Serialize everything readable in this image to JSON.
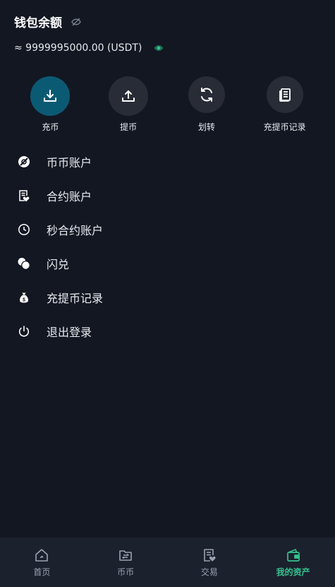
{
  "header": {
    "title": "钱包余额",
    "balance": "≈ 9999995000.00 (USDT)"
  },
  "actions": [
    {
      "label": "充币",
      "icon": "deposit-icon"
    },
    {
      "label": "提币",
      "icon": "withdraw-icon"
    },
    {
      "label": "划转",
      "icon": "transfer-icon"
    },
    {
      "label": "充提币记录",
      "icon": "records-icon"
    }
  ],
  "menu": [
    {
      "label": "币币账户",
      "icon": "coin-account-icon"
    },
    {
      "label": "合约账户",
      "icon": "contract-account-icon"
    },
    {
      "label": "秒合约账户",
      "icon": "clock-icon"
    },
    {
      "label": "闪兑",
      "icon": "flash-exchange-icon"
    },
    {
      "label": "充提币记录",
      "icon": "money-bag-icon"
    },
    {
      "label": "退出登录",
      "icon": "power-icon"
    }
  ],
  "tabs": [
    {
      "label": "首页",
      "icon": "home-icon"
    },
    {
      "label": "币币",
      "icon": "folder-icon"
    },
    {
      "label": "交易",
      "icon": "trade-icon"
    },
    {
      "label": "我的资产",
      "icon": "wallet-icon",
      "active": true
    }
  ],
  "colors": {
    "background": "#121722",
    "accent_green": "#35c28f",
    "deposit_circle": "#0b5a73",
    "circle": "#272c36",
    "tabbar": "#1b212d"
  }
}
